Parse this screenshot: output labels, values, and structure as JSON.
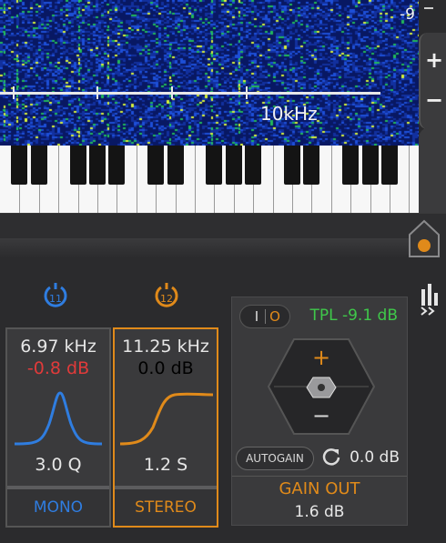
{
  "spectrogram": {
    "freq_label": "10kHz",
    "db_label": "-9",
    "zoom_in": "+",
    "zoom_out": "−"
  },
  "bands": [
    {
      "number": "11",
      "freq": "6.97 kHz",
      "gain": "-0.8 dB",
      "q": "3.0 Q",
      "mode": "MONO",
      "color": "#2f7de0",
      "gain_color": "#e03a3a",
      "mode_color": "#2f7de0"
    },
    {
      "number": "12",
      "freq": "11.25 kHz",
      "gain": "0.0 dB",
      "q": "1.2 S",
      "mode": "STEREO",
      "color": "#e08a1a",
      "gain_color": "#e6e6e6",
      "mode_color": "#e08a1a"
    }
  ],
  "gain_panel": {
    "toggle_on": "I",
    "toggle_off": "O",
    "tpl": "TPL -9.1 dB",
    "plus": "+",
    "minus": "−",
    "autogain_label": "AUTOGAIN",
    "autogain_value": "0.0 dB",
    "title": "GAIN OUT",
    "value": "1.6 dB"
  },
  "colors": {
    "accent_orange": "#e08a1a",
    "accent_blue": "#2f7de0",
    "tpl_green": "#3fc84a"
  }
}
